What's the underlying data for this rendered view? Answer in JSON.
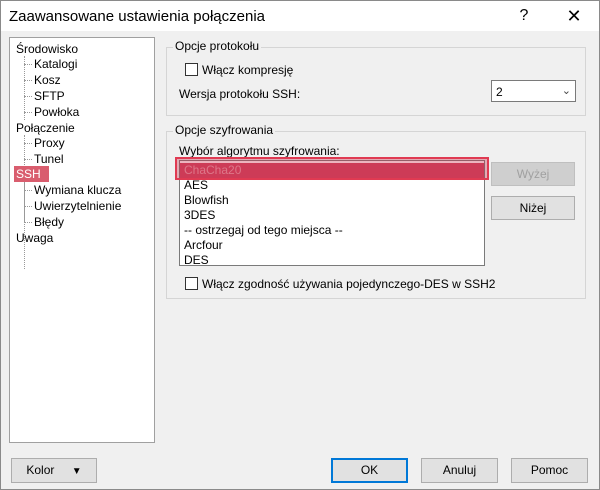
{
  "window": {
    "title": "Zaawansowane ustawienia połączenia",
    "help_glyph": "?",
    "close_glyph": "✕"
  },
  "tree": {
    "items": [
      {
        "label": "Środowisko"
      },
      {
        "label": "Katalogi"
      },
      {
        "label": "Kosz"
      },
      {
        "label": "SFTP"
      },
      {
        "label": "Powłoka"
      },
      {
        "label": "Połączenie"
      },
      {
        "label": "Proxy"
      },
      {
        "label": "Tunel"
      },
      {
        "label": "SSH"
      },
      {
        "label": "Wymiana klucza"
      },
      {
        "label": "Uwierzytelnienie"
      },
      {
        "label": "Błędy"
      },
      {
        "label": "Uwaga"
      }
    ]
  },
  "protocol": {
    "legend": "Opcje protokołu",
    "compression_label": "Włącz kompresję",
    "compression_checked": false,
    "ssh_version_label": "Wersja protokołu SSH:",
    "ssh_version_value": "2"
  },
  "encryption": {
    "legend": "Opcje szyfrowania",
    "algorithm_label": "Wybór algorytmu szyfrowania:",
    "algorithms": [
      "ChaCha20",
      "AES",
      "Blowfish",
      "3DES",
      "-- ostrzegaj od tego miejsca --",
      "Arcfour",
      "DES"
    ],
    "selected_index": 0,
    "up_button": "Wyżej",
    "down_button": "Niżej",
    "single_des_label": "Włącz zgodność używania pojedynczego-DES w SSH2",
    "single_des_checked": false
  },
  "footer": {
    "color_button": "Kolor",
    "ok_button": "OK",
    "cancel_button": "Anuluj",
    "help_button": "Pomoc"
  },
  "colors": {
    "selection": "#cf4561",
    "highlight_outline": "#e03a52",
    "default_button_border": "#0078d7"
  }
}
